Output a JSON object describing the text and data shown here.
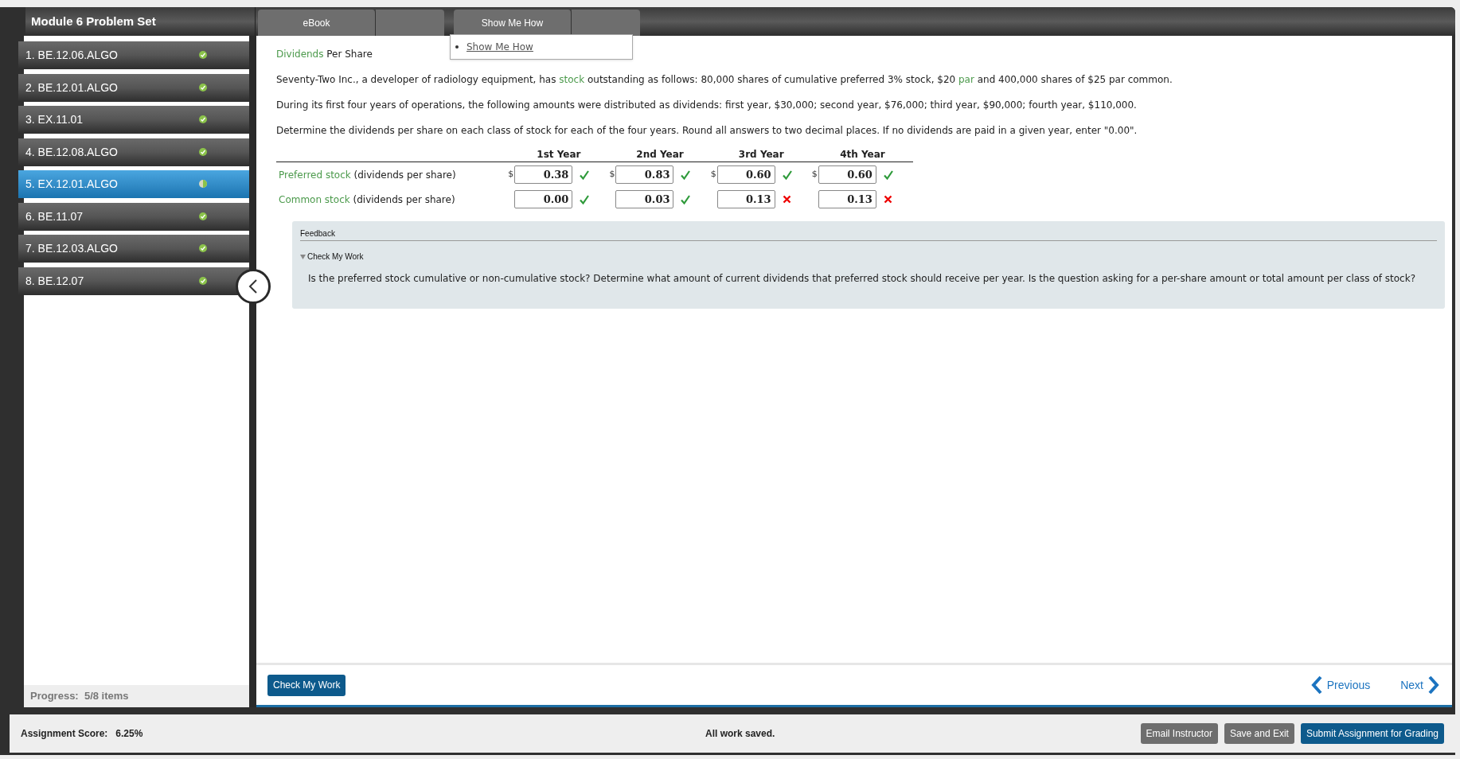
{
  "header": {
    "title": "Module 6 Problem Set"
  },
  "tabs": [
    {
      "label": "eBook"
    },
    {
      "label": "Show Me How"
    }
  ],
  "dropdown": {
    "items": [
      "Show Me How"
    ]
  },
  "sidebar": {
    "items": [
      {
        "label": "1. BE.12.06.ALGO",
        "selected": false,
        "kind": "complete"
      },
      {
        "label": "2. BE.12.01.ALGO",
        "selected": false,
        "kind": "complete"
      },
      {
        "label": "3. EX.11.01",
        "selected": false,
        "kind": "complete"
      },
      {
        "label": "4. BE.12.08.ALGO",
        "selected": false,
        "kind": "complete"
      },
      {
        "label": "5. EX.12.01.ALGO",
        "selected": true,
        "kind": "partial"
      },
      {
        "label": "6. BE.11.07",
        "selected": false,
        "kind": "complete"
      },
      {
        "label": "7. BE.12.03.ALGO",
        "selected": false,
        "kind": "complete"
      },
      {
        "label": "8. BE.12.07",
        "selected": false,
        "kind": "complete"
      }
    ],
    "progress": "Progress:  5/8 items"
  },
  "problem": {
    "title": [
      {
        "kind": "term",
        "text": "Dividends"
      },
      {
        "kind": "text",
        "text": " Per Share"
      }
    ],
    "paragraphs": [
      [
        {
          "kind": "text",
          "text": "Seventy-Two Inc., a developer of radiology equipment, has "
        },
        {
          "kind": "term",
          "text": "stock"
        },
        {
          "kind": "text",
          "text": " outstanding as follows: 80,000 shares of cumulative preferred 3% stock, $20 "
        },
        {
          "kind": "term",
          "text": "par"
        },
        {
          "kind": "text",
          "text": " and 400,000 shares of $25 par common."
        }
      ],
      [
        {
          "kind": "text",
          "text": "During its first four years of operations, the following amounts were distributed as dividends: first year, $30,000; second year, $76,000; third year, $90,000; fourth year, $110,000."
        }
      ],
      [
        {
          "kind": "text",
          "text": "Determine the dividends per share on each class of stock for each of the four years. Round all answers to two decimal places. If no dividends are paid in a given year, enter \"0.00\"."
        }
      ]
    ]
  },
  "table": {
    "columns": [
      "1st Year",
      "2nd Year",
      "3rd Year",
      "4th Year"
    ],
    "rows": [
      {
        "term": "Preferred stock",
        "label": " (dividends per share)",
        "cells": [
          {
            "currency": "$",
            "value": "0.38",
            "kind": "correct"
          },
          {
            "currency": "$",
            "value": "0.83",
            "kind": "correct"
          },
          {
            "currency": "$",
            "value": "0.60",
            "kind": "correct"
          },
          {
            "currency": "$",
            "value": "0.60",
            "kind": "correct"
          }
        ]
      },
      {
        "term": "Common stock",
        "label": " (dividends per share)",
        "cells": [
          {
            "value": "0.00",
            "kind": "correct"
          },
          {
            "value": "0.03",
            "kind": "correct"
          },
          {
            "value": "0.13",
            "kind": "incorrect"
          },
          {
            "value": "0.13",
            "kind": "incorrect"
          }
        ]
      }
    ]
  },
  "feedback": {
    "title": "Feedback",
    "section": "Check My Work",
    "expanded": true,
    "text": "Is the preferred stock cumulative or non-cumulative stock? Determine what amount of current dividends that preferred stock should receive per year. Is the question asking for a per-share amount or total amount per class of stock?"
  },
  "nav": {
    "check_button": "Check My Work",
    "previous": "Previous",
    "next": "Next"
  },
  "footer": {
    "score_label": "Assignment Score:",
    "score": "6.25%",
    "status": "All work saved.",
    "buttons": [
      "Email Instructor",
      "Save and Exit",
      "Submit Assignment for Grading"
    ]
  }
}
